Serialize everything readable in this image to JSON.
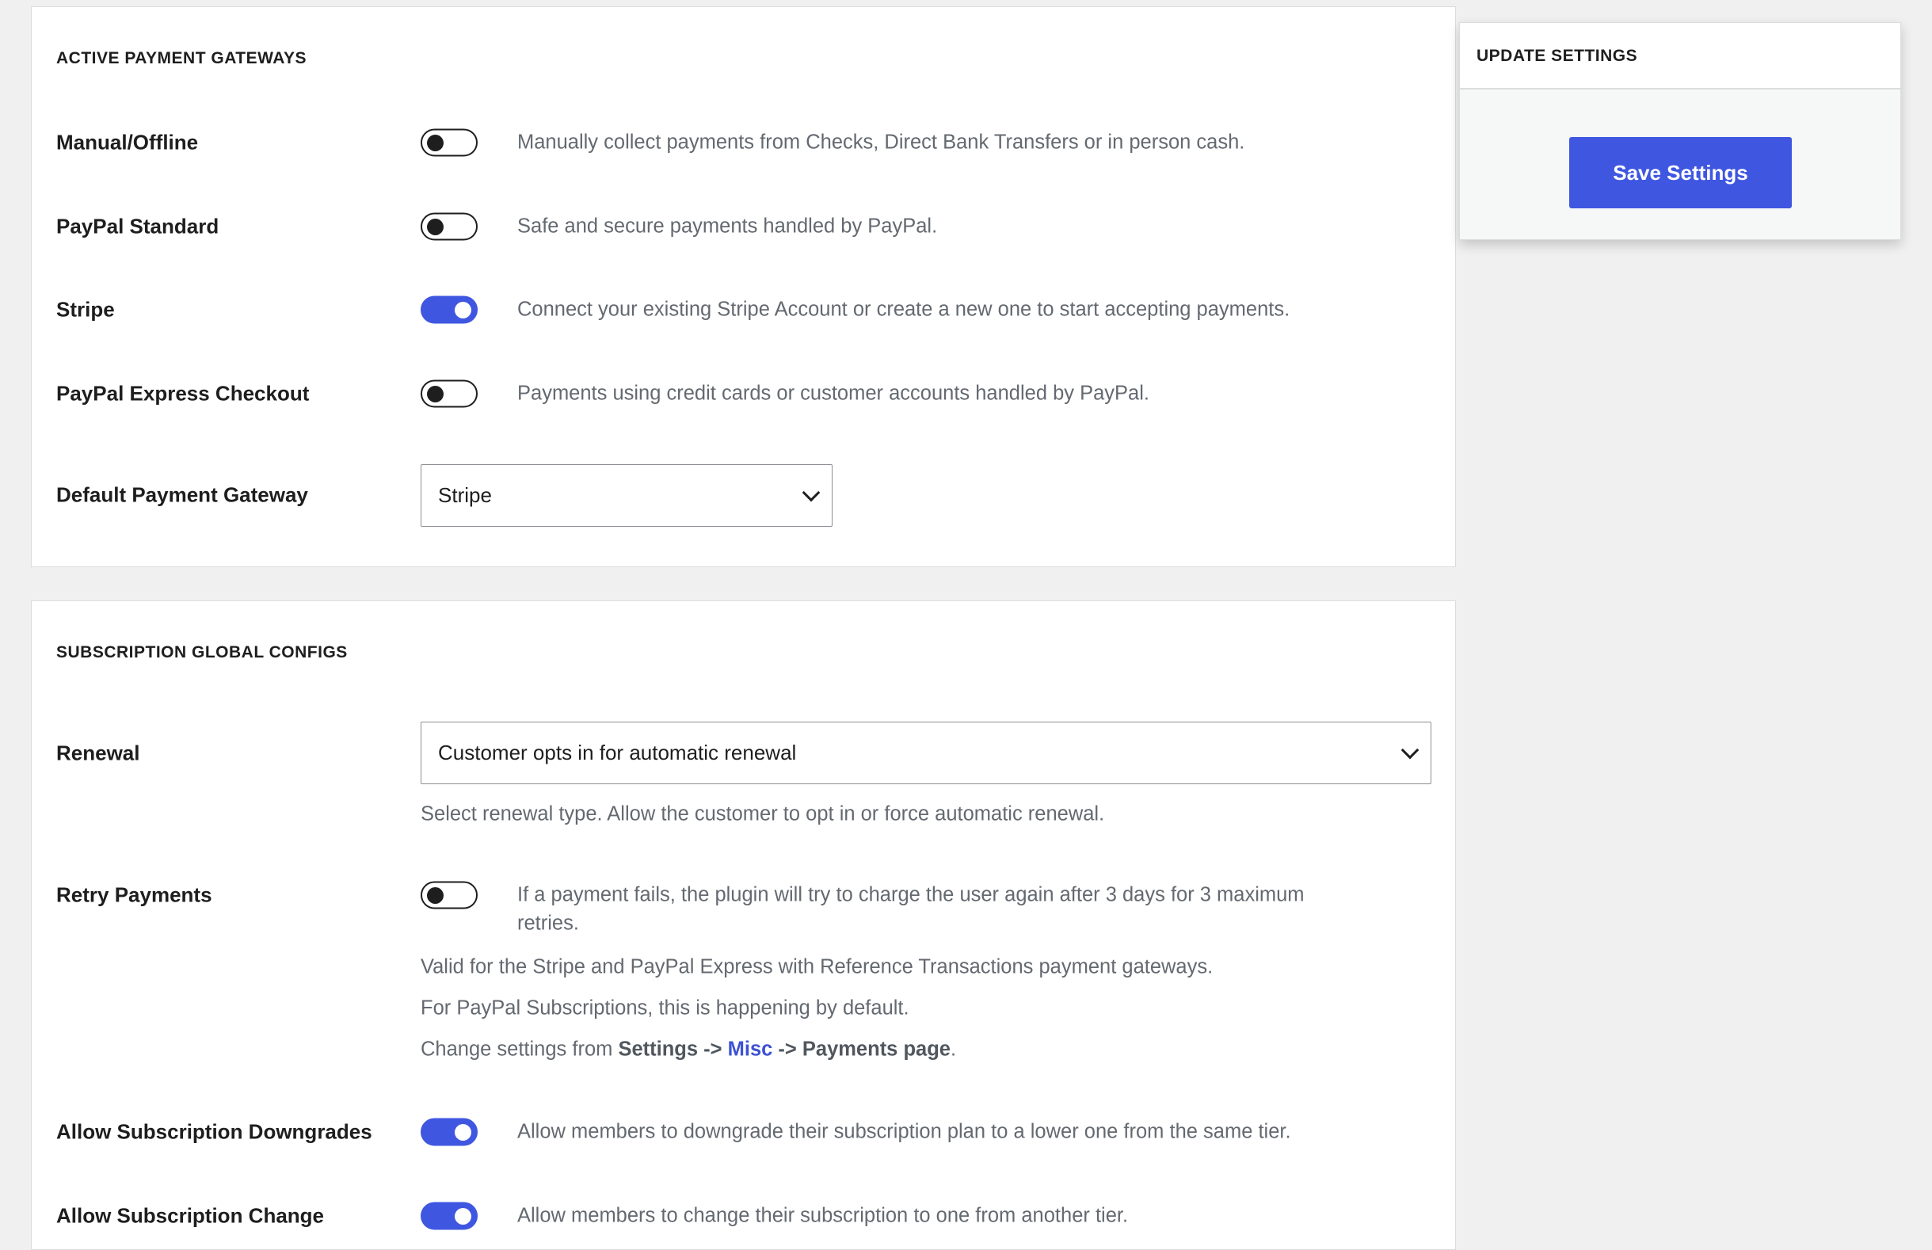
{
  "gateways": {
    "heading": "ACTIVE PAYMENT GATEWAYS",
    "rows": [
      {
        "label": "Manual/Offline",
        "enabled": false,
        "description": "Manually collect payments from Checks, Direct Bank Transfers or in person cash."
      },
      {
        "label": "PayPal Standard",
        "enabled": false,
        "description": "Safe and secure payments handled by PayPal."
      },
      {
        "label": "Stripe",
        "enabled": true,
        "description": "Connect your existing Stripe Account or create a new one to start accepting payments."
      },
      {
        "label": "PayPal Express Checkout",
        "enabled": false,
        "description": "Payments using credit cards or customer accounts handled by PayPal."
      }
    ],
    "default_label": "Default Payment Gateway",
    "default_value": "Stripe"
  },
  "subscription": {
    "heading": "SUBSCRIPTION GLOBAL CONFIGS",
    "renewal_label": "Renewal",
    "renewal_value": "Customer opts in for automatic renewal",
    "renewal_help": "Select renewal type. Allow the customer to opt in or force automatic renewal.",
    "retry_label": "Retry Payments",
    "retry_enabled": false,
    "retry_desc_line1": "If a payment fails, the plugin will try to charge the user again after 3 days for 3 maximum",
    "retry_desc_line2": "retries.",
    "retry_note1": "Valid for the Stripe and PayPal Express with Reference Transactions payment gateways.",
    "retry_note2": "For PayPal Subscriptions, this is happening by default.",
    "retry_note3_prefix": "Change settings from ",
    "retry_note3_settings": "Settings ->",
    "retry_note3_misc": "Misc",
    "retry_note3_payments": "-> Payments page",
    "retry_note3_suffix": ".",
    "downgrades_label": "Allow Subscription Downgrades",
    "downgrades_enabled": true,
    "downgrades_desc": "Allow members to downgrade their subscription plan to a lower one from the same tier.",
    "change_label": "Allow Subscription Change",
    "change_enabled": true,
    "change_desc": "Allow members to change their subscription to one from another tier."
  },
  "sidebar": {
    "heading": "UPDATE SETTINGS",
    "save_label": "Save Settings"
  },
  "colors": {
    "accent": "#3f57e0",
    "background": "#f0f0f1",
    "link": "#3d52d5"
  }
}
